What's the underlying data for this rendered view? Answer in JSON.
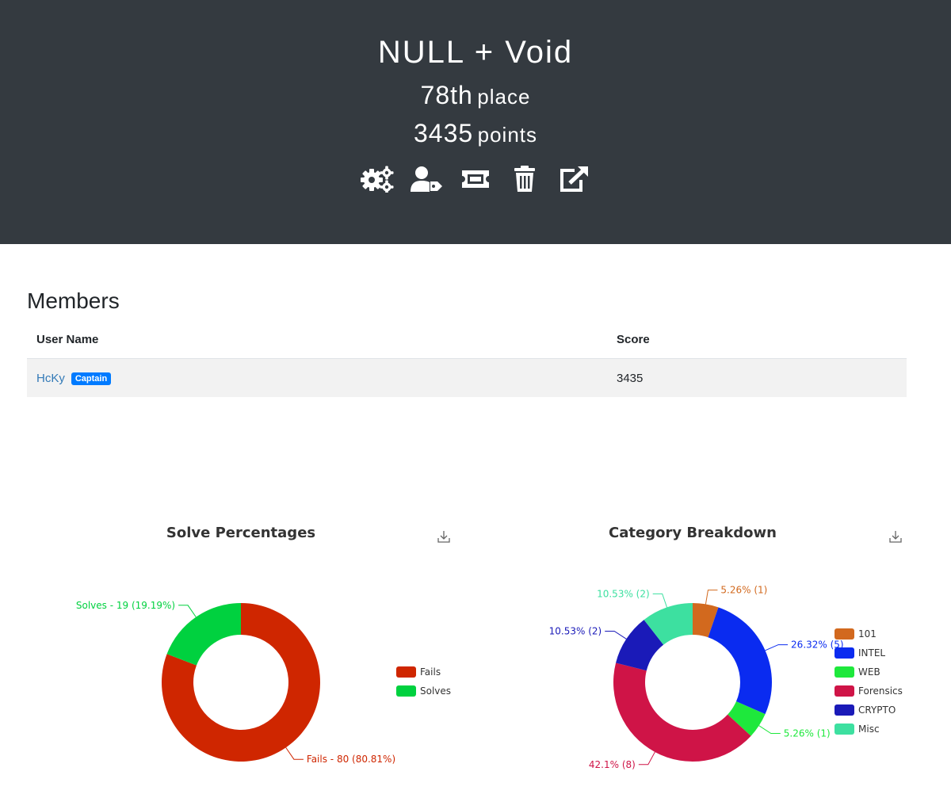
{
  "team": {
    "name": "NULL + Void",
    "place_value": "78th",
    "place_label": "place",
    "points_value": "3435",
    "points_label": "points"
  },
  "actions": [
    {
      "icon": "gears-icon"
    },
    {
      "icon": "user-tag-icon"
    },
    {
      "icon": "ticket-icon"
    },
    {
      "icon": "trash-icon"
    },
    {
      "icon": "external-link-icon"
    }
  ],
  "members": {
    "title": "Members",
    "columns": [
      "User Name",
      "Score"
    ],
    "rows": [
      {
        "name": "HcKy",
        "badge": "Captain",
        "score": "3435"
      }
    ]
  },
  "colors": {
    "header_bg": "#343a40",
    "link": "#337ab7",
    "badge": "#007bff"
  },
  "chart_data": [
    {
      "type": "pie",
      "title": "Solve Percentages",
      "categories": [
        "Fails",
        "Solves"
      ],
      "values": [
        80,
        19
      ],
      "colors": [
        "#cf2600",
        "#00d13f"
      ],
      "labels": [
        "Fails - 80 (80.81%)",
        "Solves - 19 (19.19%)"
      ],
      "legend": "right"
    },
    {
      "type": "pie",
      "title": "Category Breakdown",
      "categories": [
        "101",
        "INTEL",
        "WEB",
        "Forensics",
        "CRYPTO",
        "Misc"
      ],
      "values": [
        1,
        5,
        1,
        8,
        2,
        2
      ],
      "colors": [
        "#d2691e",
        "#0a2bf0",
        "#1ee83c",
        "#cf1447",
        "#1a1ab8",
        "#3de0a0"
      ],
      "labels": [
        "5.26% (1)",
        "26.32% (5)",
        "5.26% (1)",
        "42.1% (8)",
        "10.53% (2)",
        "10.53% (2)"
      ],
      "legend": "right"
    }
  ]
}
